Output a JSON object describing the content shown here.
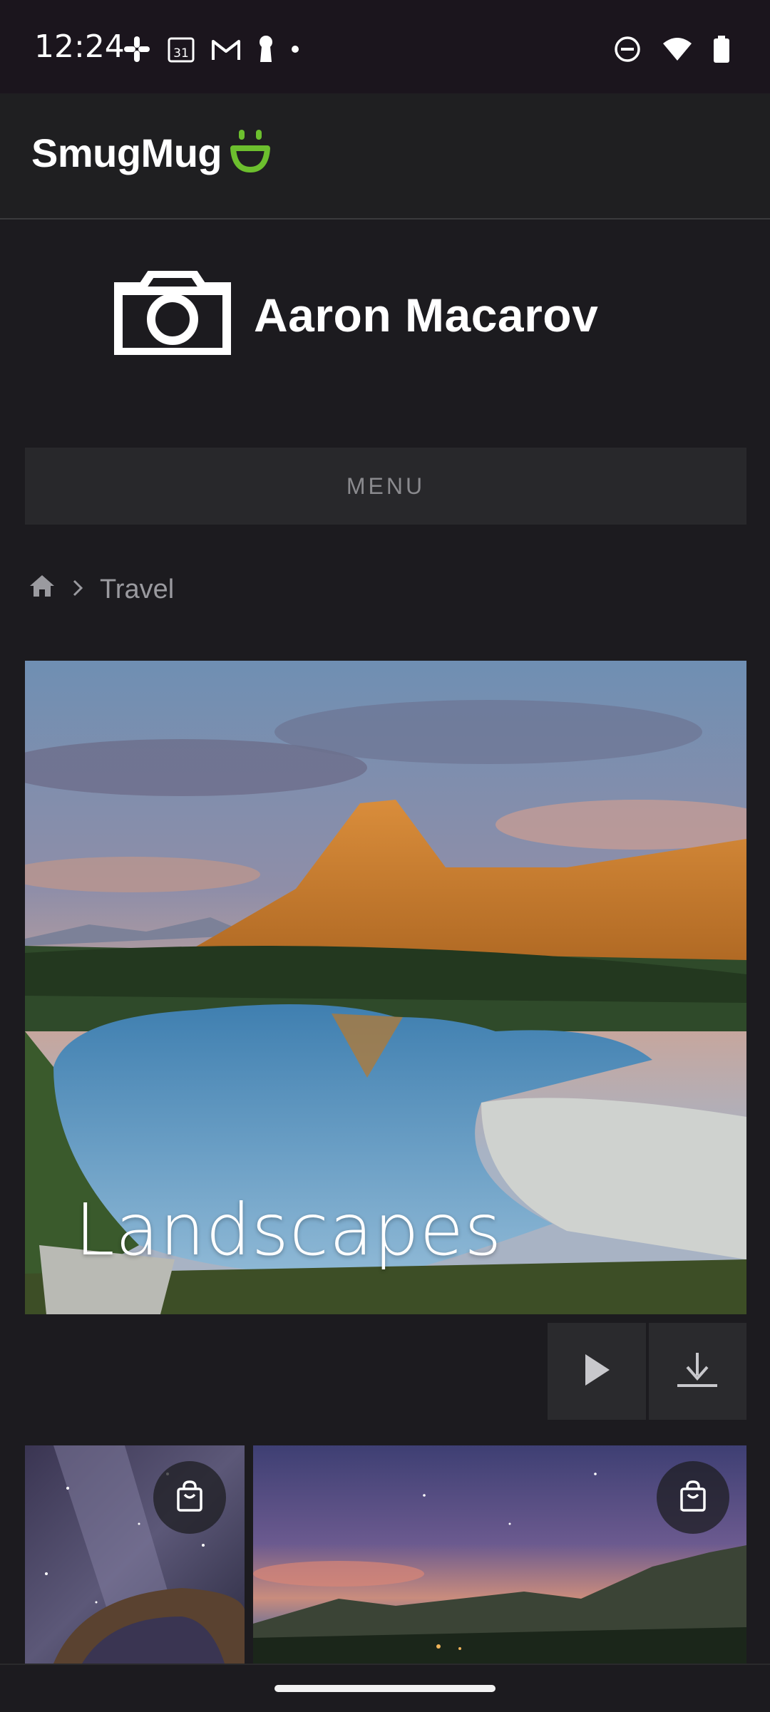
{
  "status_bar": {
    "time": "12:24",
    "icons_left": [
      "slack-icon",
      "calendar-icon",
      "gmail-icon",
      "keyhole-icon",
      "dot-icon"
    ],
    "calendar_day": "31",
    "icons_right": [
      "do-not-disturb-icon",
      "wifi-icon",
      "battery-icon"
    ]
  },
  "app_bar": {
    "logo_text": "SmugMug",
    "logo_accent_color": "#6cbf2e"
  },
  "site_header": {
    "owner_name": "Aaron Macarov",
    "logo_icon": "camera-icon"
  },
  "menu": {
    "label": "MENU"
  },
  "breadcrumb": {
    "home_icon": "home-icon",
    "separator_icon": "chevron-right-icon",
    "current": "Travel"
  },
  "hero": {
    "title": "Landscapes"
  },
  "actions": {
    "slideshow_icon": "play-icon",
    "download_icon": "download-icon"
  },
  "thumbnails": [
    {
      "name": "milky-way-arch",
      "cart_icon": "shopping-bag-icon"
    },
    {
      "name": "twilight-mountains",
      "cart_icon": "shopping-bag-icon"
    }
  ]
}
